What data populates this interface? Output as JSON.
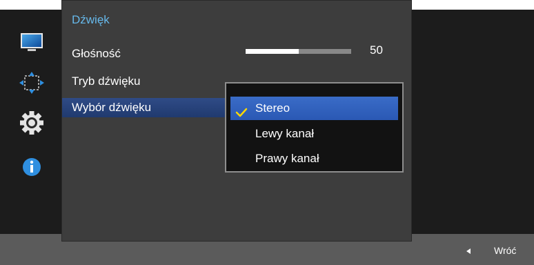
{
  "sidebar": {
    "icons": [
      "monitor-icon",
      "move-arrows-icon",
      "gear-icon",
      "info-icon"
    ]
  },
  "panel": {
    "title": "Dźwięk",
    "items": [
      {
        "label": "Głośność"
      },
      {
        "label": "Tryb dźwięku"
      },
      {
        "label": "Wybór dźwięku",
        "selected": true
      }
    ],
    "volume": {
      "value": "50",
      "level": 0.5
    }
  },
  "dropdown": {
    "options": [
      {
        "label": "Stereo",
        "selected": true
      },
      {
        "label": "Lewy kanał"
      },
      {
        "label": "Prawy kanał"
      }
    ]
  },
  "footer": {
    "back_label": "Wróć"
  },
  "colors": {
    "title_accent": "#66b8ea",
    "selection_blue": "#2f5db8",
    "check_yellow": "#ffd800"
  }
}
